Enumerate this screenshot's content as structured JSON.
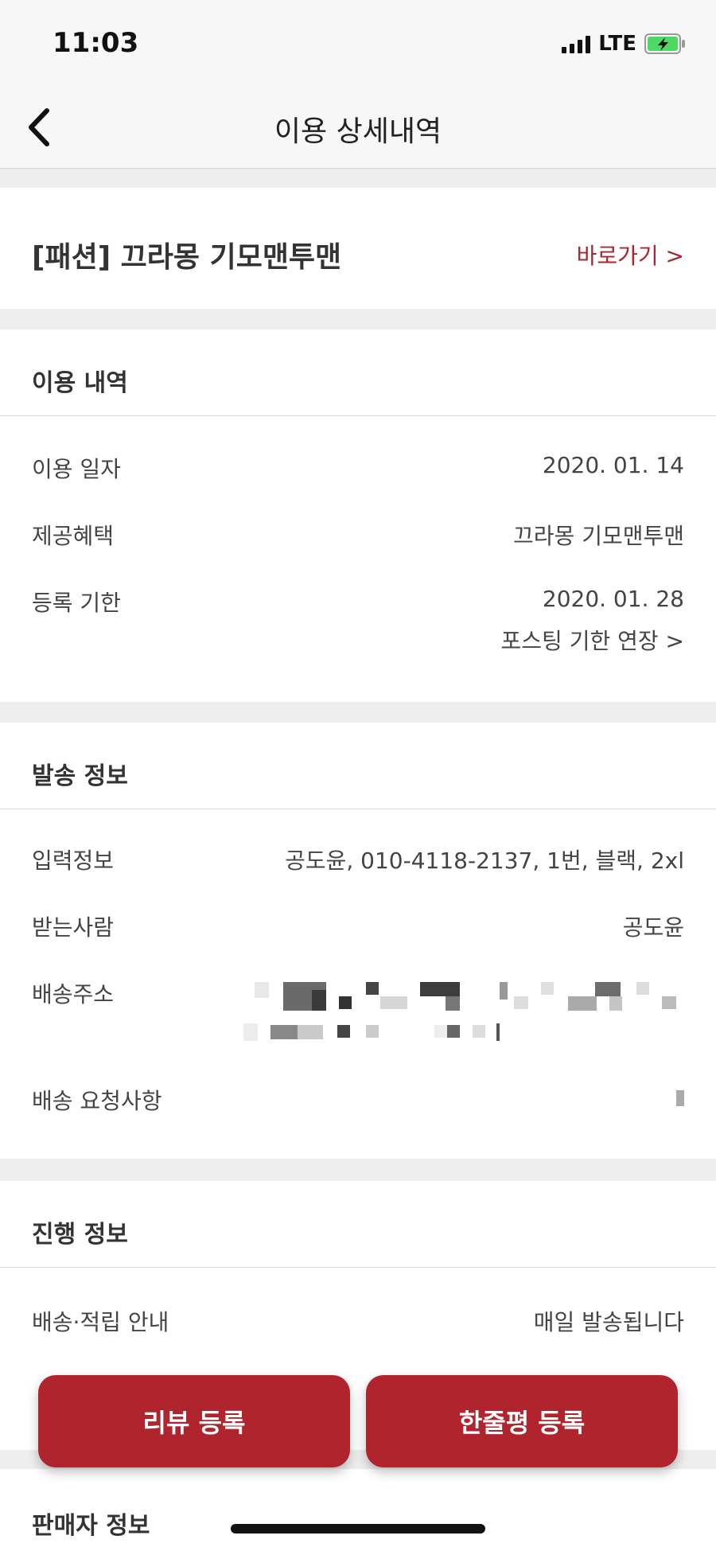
{
  "status_bar": {
    "time": "11:03",
    "network": "LTE"
  },
  "navbar": {
    "title": "이용 상세내역"
  },
  "product": {
    "title": "[패션] 끄라몽 기모맨투맨",
    "link_label": "바로가기 >"
  },
  "usage": {
    "title": "이용 내역",
    "rows": [
      {
        "label": "이용 일자",
        "value": "2020. 01. 14"
      },
      {
        "label": "제공혜택",
        "value": "끄라몽 기모맨투맨"
      },
      {
        "label": "등록 기한",
        "value": "2020. 01. 28"
      }
    ],
    "extend_link": "포스팅 기한 연장 >"
  },
  "shipping": {
    "title": "발송 정보",
    "rows": [
      {
        "label": "입력정보",
        "value": "공도윤, 010-4118-2137, 1번, 블랙, 2xl"
      },
      {
        "label": "받는사람",
        "value": "공도윤"
      },
      {
        "label": "배송주소",
        "value": ""
      },
      {
        "label": "배송 요청사항",
        "value": ""
      }
    ]
  },
  "progress": {
    "title": "진행 정보",
    "rows": [
      {
        "label": "배송·적립 안내",
        "value": "매일 발송됩니다"
      }
    ]
  },
  "seller": {
    "title": "판매자 정보"
  },
  "actions": {
    "review_label": "리뷰 등록",
    "oneline_label": "한줄평 등록"
  },
  "colors": {
    "accent": "#b0242e",
    "link": "#a8272f",
    "background": "#efeeee"
  },
  "icons": {
    "back": "chevron-left-icon",
    "battery": "battery-charging-icon",
    "signal": "signal-bars-icon"
  }
}
